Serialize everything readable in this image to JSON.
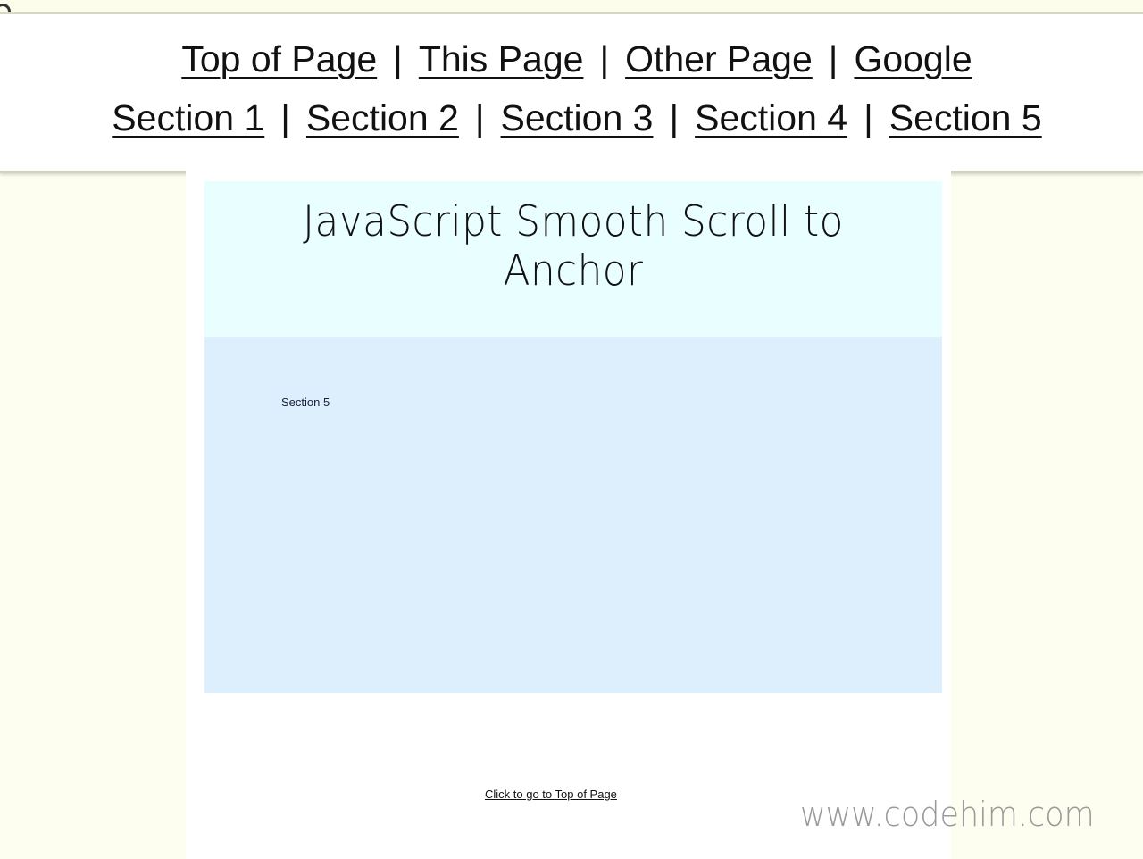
{
  "nav": {
    "row1": [
      {
        "label": "Top of Page"
      },
      {
        "label": "This Page"
      },
      {
        "label": "Other Page"
      },
      {
        "label": "Google"
      }
    ],
    "row2": [
      {
        "label": "Section 1"
      },
      {
        "label": "Section 2"
      },
      {
        "label": "Section 3"
      },
      {
        "label": "Section 4"
      },
      {
        "label": "Section 5"
      }
    ],
    "separator": "|"
  },
  "header": {
    "title": "JavaScript Smooth Scroll to Anchor"
  },
  "section": {
    "label": "Section 5"
  },
  "footer": {
    "back_to_top": "Click to go to Top of Page"
  },
  "watermark": "www.codehim.com",
  "colors": {
    "page_bg": "#fefef0",
    "header_bg": "#e8feff",
    "section_bg": "#ddeefd"
  }
}
